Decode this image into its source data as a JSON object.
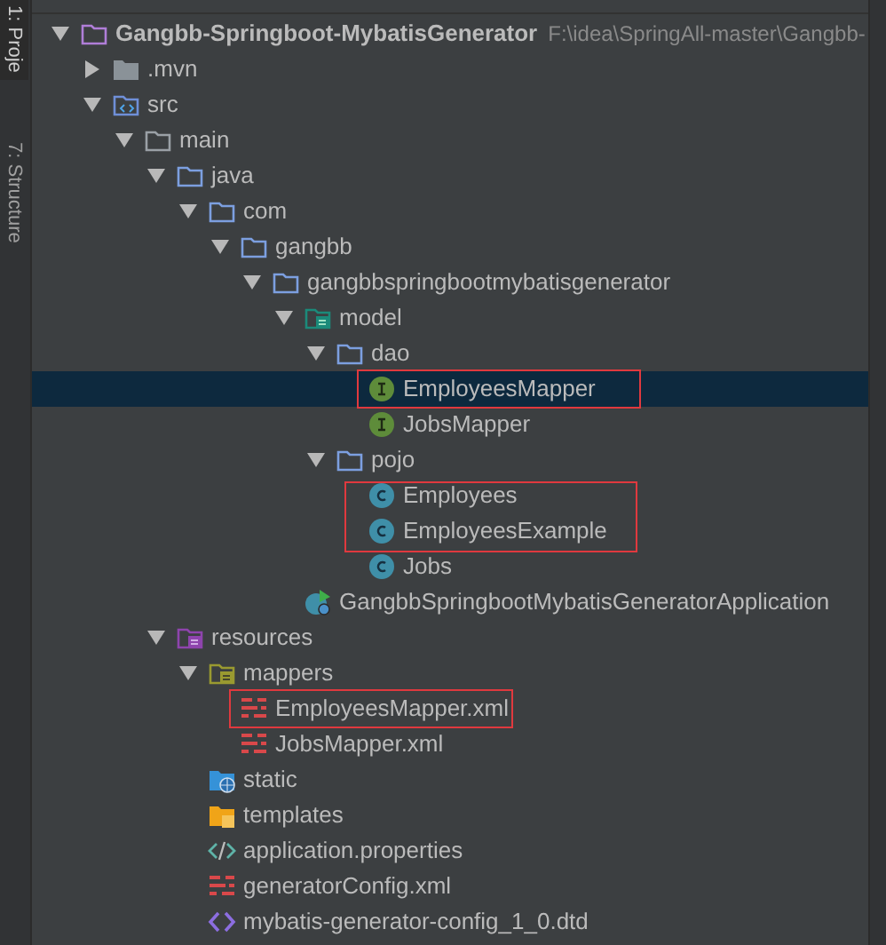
{
  "side_tabs": [
    {
      "label": "1: Proje",
      "selected": true
    },
    {
      "label": "7: Structure",
      "selected": false
    }
  ],
  "tree": [
    {
      "kind": "project",
      "label": "Gangbb-Springboot-MybatisGenerator",
      "path": "F:\\idea\\SpringAll-master\\Gangbb-",
      "expanded": true,
      "selected": false,
      "children": [
        {
          "kind": "excluded-folder",
          "label": ".mvn",
          "expanded": false,
          "selected": false
        },
        {
          "kind": "source-root",
          "label": "src",
          "expanded": true,
          "selected": false,
          "children": [
            {
              "kind": "folder",
              "label": "main",
              "expanded": true,
              "selected": false,
              "children": [
                {
                  "kind": "package",
                  "label": "java",
                  "expanded": true,
                  "selected": false,
                  "children": [
                    {
                      "kind": "package",
                      "label": "com",
                      "expanded": true,
                      "selected": false,
                      "children": [
                        {
                          "kind": "package",
                          "label": "gangbb",
                          "expanded": true,
                          "selected": false,
                          "children": [
                            {
                              "kind": "package",
                              "label": "gangbbspringbootmybatisgenerator",
                              "expanded": true,
                              "selected": false,
                              "children": [
                                {
                                  "kind": "module",
                                  "label": "model",
                                  "expanded": true,
                                  "selected": false,
                                  "children": [
                                    {
                                      "kind": "package",
                                      "label": "dao",
                                      "expanded": true,
                                      "selected": false,
                                      "children": [
                                        {
                                          "kind": "interface",
                                          "label": "EmployeesMapper",
                                          "selected": true,
                                          "framed": true
                                        },
                                        {
                                          "kind": "interface",
                                          "label": "JobsMapper",
                                          "selected": false
                                        }
                                      ]
                                    },
                                    {
                                      "kind": "package",
                                      "label": "pojo",
                                      "expanded": true,
                                      "selected": false,
                                      "children": [
                                        {
                                          "kind": "class",
                                          "label": "Employees",
                                          "selected": false,
                                          "framed": true
                                        },
                                        {
                                          "kind": "class",
                                          "label": "EmployeesExample",
                                          "selected": false,
                                          "framed": true
                                        },
                                        {
                                          "kind": "class",
                                          "label": "Jobs",
                                          "selected": false
                                        }
                                      ]
                                    }
                                  ]
                                },
                                {
                                  "kind": "spring-app",
                                  "label": "GangbbSpringbootMybatisGeneratorApplication",
                                  "selected": false
                                }
                              ]
                            }
                          ]
                        }
                      ]
                    }
                  ]
                },
                {
                  "kind": "resources-root",
                  "label": "resources",
                  "expanded": true,
                  "selected": false,
                  "children": [
                    {
                      "kind": "resource-folder",
                      "label": "mappers",
                      "expanded": true,
                      "selected": false,
                      "children": [
                        {
                          "kind": "xml",
                          "label": "EmployeesMapper.xml",
                          "selected": false,
                          "framed": true
                        },
                        {
                          "kind": "xml",
                          "label": "JobsMapper.xml",
                          "selected": false
                        }
                      ]
                    },
                    {
                      "kind": "web-folder",
                      "label": "static",
                      "selected": false
                    },
                    {
                      "kind": "template-folder",
                      "label": "templates",
                      "selected": false
                    },
                    {
                      "kind": "properties",
                      "label": "application.properties",
                      "selected": false
                    },
                    {
                      "kind": "xml",
                      "label": "generatorConfig.xml",
                      "selected": false
                    },
                    {
                      "kind": "dtd",
                      "label": "mybatis-generator-config_1_0.dtd",
                      "selected": false
                    }
                  ]
                }
              ]
            }
          ]
        }
      ]
    }
  ]
}
